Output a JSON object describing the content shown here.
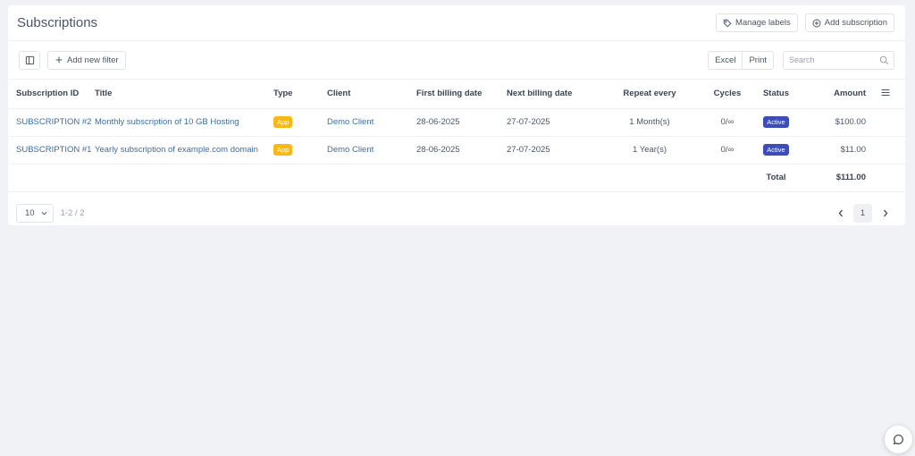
{
  "header": {
    "title": "Subscriptions",
    "manage_labels": "Manage labels",
    "add_subscription": "Add subscription"
  },
  "toolbar": {
    "add_filter": "Add new filter",
    "excel": "Excel",
    "print": "Print",
    "search_placeholder": "Search"
  },
  "table": {
    "columns": [
      "Subscription ID",
      "Title",
      "Type",
      "Client",
      "First billing date",
      "Next billing date",
      "Repeat every",
      "Cycles",
      "Status",
      "Amount"
    ],
    "rows": [
      {
        "id": "SUBSCRIPTION #2",
        "title": "Monthly subscription of 10 GB Hosting",
        "type": "App",
        "client": "Demo Client",
        "first_billing": "28-06-2025",
        "next_billing": "27-07-2025",
        "repeat": "1 Month(s)",
        "cycles": "0/∞",
        "status": "Active",
        "amount": "$100.00"
      },
      {
        "id": "SUBSCRIPTION #1",
        "title": "Yearly subscription of example.com domain",
        "type": "App",
        "client": "Demo Client",
        "first_billing": "28-06-2025",
        "next_billing": "27-07-2025",
        "repeat": "1 Year(s)",
        "cycles": "0/∞",
        "status": "Active",
        "amount": "$11.00"
      }
    ],
    "total_label": "Total",
    "total_amount": "$111.00"
  },
  "pagination": {
    "page_size": "10",
    "range": "1-2 / 2",
    "current_page": "1"
  },
  "colors": {
    "link": "#3a6ea5",
    "app_badge": "#f9b812",
    "active_badge": "#3d4db7",
    "background": "#f1f2f6"
  },
  "icons": [
    "tag-icon",
    "plus-circle-icon",
    "columns-icon",
    "plus-icon",
    "search-icon",
    "menu-icon",
    "chevron-down-icon",
    "chevron-left-icon",
    "chevron-right-icon",
    "chat-icon"
  ]
}
